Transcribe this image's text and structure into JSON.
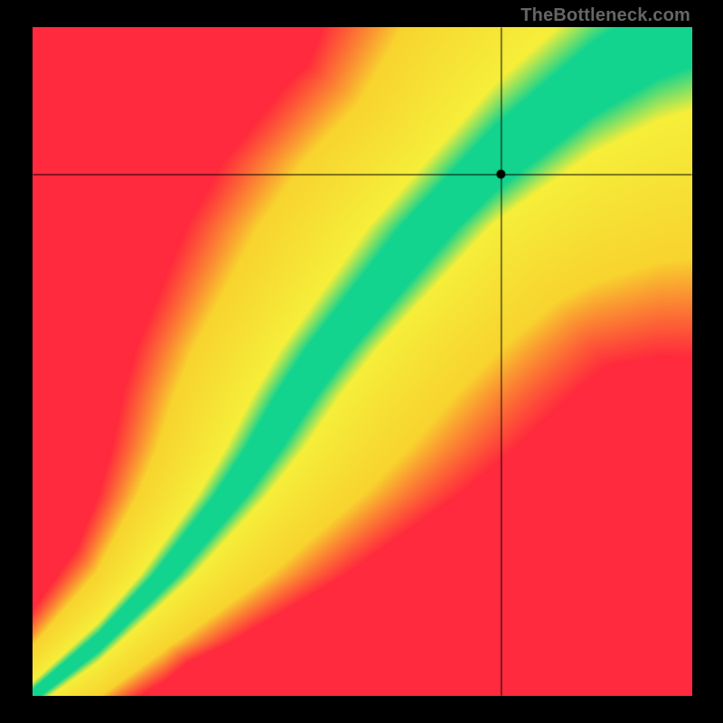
{
  "watermark": "TheBottleneck.com",
  "chart_data": {
    "type": "heatmap",
    "title": "",
    "xlabel": "",
    "ylabel": "",
    "xlim": [
      0,
      1
    ],
    "ylim": [
      0,
      1
    ],
    "crosshair": {
      "x": 0.71,
      "y": 0.78
    },
    "marker_radius": 5,
    "optimal_curve": [
      {
        "x": 0.0,
        "y": 0.0
      },
      {
        "x": 0.05,
        "y": 0.04
      },
      {
        "x": 0.1,
        "y": 0.08
      },
      {
        "x": 0.15,
        "y": 0.13
      },
      {
        "x": 0.2,
        "y": 0.18
      },
      {
        "x": 0.25,
        "y": 0.24
      },
      {
        "x": 0.3,
        "y": 0.3
      },
      {
        "x": 0.35,
        "y": 0.37
      },
      {
        "x": 0.4,
        "y": 0.45
      },
      {
        "x": 0.45,
        "y": 0.52
      },
      {
        "x": 0.5,
        "y": 0.58
      },
      {
        "x": 0.55,
        "y": 0.64
      },
      {
        "x": 0.6,
        "y": 0.7
      },
      {
        "x": 0.65,
        "y": 0.75
      },
      {
        "x": 0.7,
        "y": 0.8
      },
      {
        "x": 0.75,
        "y": 0.84
      },
      {
        "x": 0.8,
        "y": 0.88
      },
      {
        "x": 0.85,
        "y": 0.92
      },
      {
        "x": 0.9,
        "y": 0.95
      },
      {
        "x": 0.95,
        "y": 0.98
      },
      {
        "x": 1.0,
        "y": 1.0
      }
    ],
    "band_inner_halfwidth": 0.035,
    "band_mid_halfwidth": 0.075,
    "colors": {
      "good": "#12d48f",
      "near": "#f6ef3a",
      "mid": "#fca41c",
      "far": "#ff2a3d"
    },
    "crosshair_color": "#000000"
  }
}
